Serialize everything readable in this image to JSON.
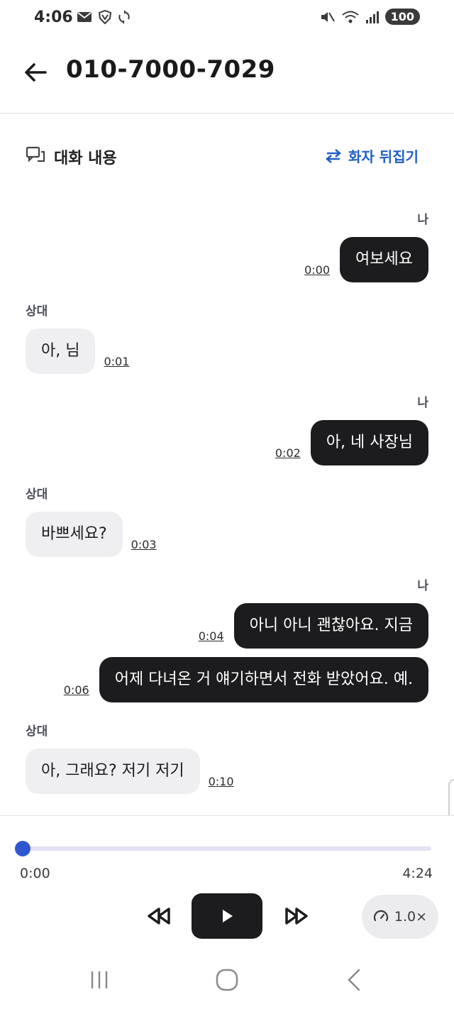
{
  "status_bar": {
    "time": "4:06",
    "battery": "100"
  },
  "header": {
    "title": "010-7000-7029"
  },
  "section": {
    "title": "대화 내용",
    "flip_label": "화자 뒤집기"
  },
  "speakers": {
    "me": "나",
    "other": "상대"
  },
  "messages": [
    {
      "speaker": "나",
      "text": "여보세요",
      "time": "0:00"
    },
    {
      "speaker": "상대",
      "text": "아, 님",
      "time": "0:01"
    },
    {
      "speaker": "나",
      "text": "아, 네 사장님",
      "time": "0:02"
    },
    {
      "speaker": "상대",
      "text": "바쁘세요?",
      "time": "0:03"
    },
    {
      "speaker": "나",
      "text": "아니 아니 괜찮아요. 지금",
      "time": "0:04"
    },
    {
      "speaker": "나",
      "text": "어제 다녀온 거 얘기하면서 전화 받았어요. 예.",
      "time": "0:06"
    },
    {
      "speaker": "상대",
      "text": "아, 그래요? 저기 저기",
      "time": "0:10"
    }
  ],
  "player": {
    "current_time": "0:00",
    "total_time": "4:24",
    "progress": 0,
    "speed": "1.0×"
  },
  "colors": {
    "accent": "#2f58d0",
    "link": "#1f5fc4",
    "bubble_me": "#1c1c1e",
    "bubble_other": "#efeff1"
  }
}
